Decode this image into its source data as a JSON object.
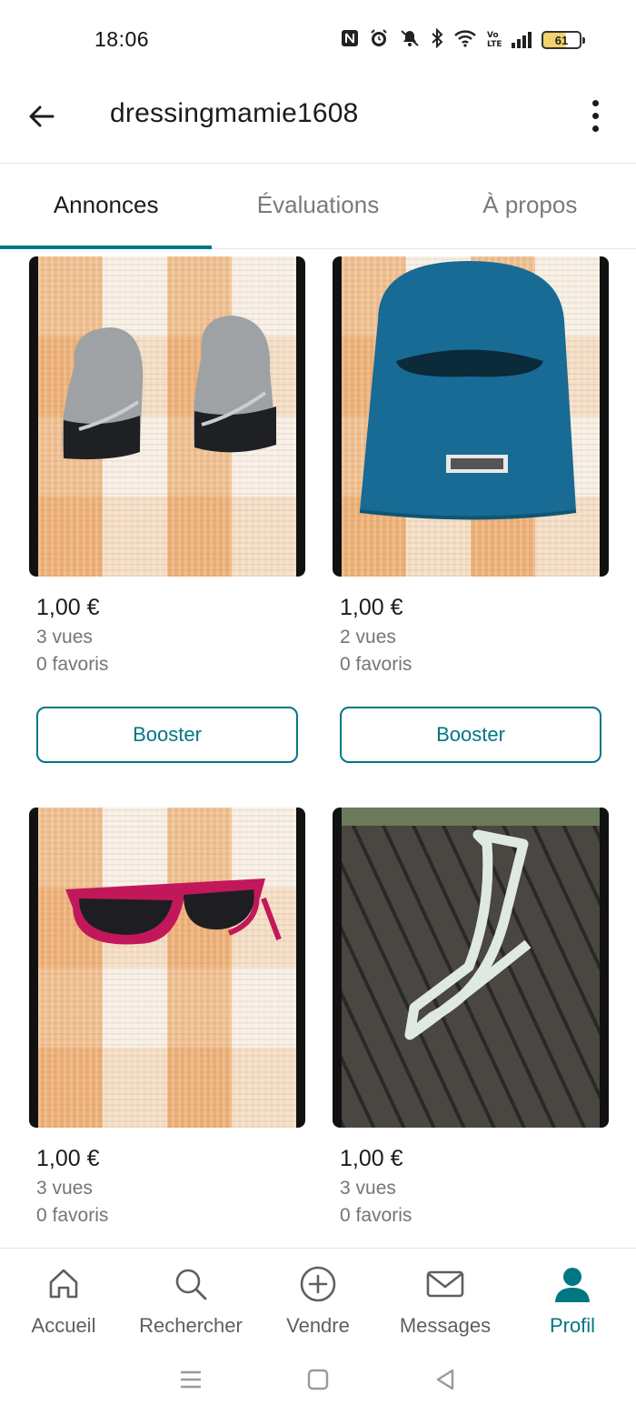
{
  "status_bar": {
    "time": "18:06",
    "battery": "61",
    "icons": [
      "nfc-icon",
      "alarm-icon",
      "mute-icon",
      "bluetooth-icon",
      "wifi-icon",
      "volte-icon",
      "signal-icon",
      "battery-icon"
    ]
  },
  "header": {
    "title": "dressingmamie1608",
    "back_icon": "arrow-left-icon",
    "more_icon": "more-vertical-icon"
  },
  "tabs": [
    {
      "label": "Annonces",
      "active": true
    },
    {
      "label": "Évaluations",
      "active": false
    },
    {
      "label": "À propos",
      "active": false
    }
  ],
  "listings": [
    {
      "price": "1,00 €",
      "views": "3 vues",
      "favorites": "0 favoris",
      "button": "Booster",
      "image": "gloves-photo"
    },
    {
      "price": "1,00 €",
      "views": "2 vues",
      "favorites": "0 favoris",
      "button": "Booster",
      "image": "balaclava-photo"
    },
    {
      "price": "1,00 €",
      "views": "3 vues",
      "favorites": "0 favoris",
      "image": "sunglasses-photo"
    },
    {
      "price": "1,00 €",
      "views": "3 vues",
      "favorites": "0 favoris",
      "image": "lanyard-photo"
    }
  ],
  "bottom_nav": [
    {
      "label": "Accueil",
      "icon": "home-icon"
    },
    {
      "label": "Rechercher",
      "icon": "search-icon"
    },
    {
      "label": "Vendre",
      "icon": "plus-circle-icon"
    },
    {
      "label": "Messages",
      "icon": "mail-icon"
    },
    {
      "label": "Profil",
      "icon": "profile-icon",
      "active": true
    }
  ],
  "colors": {
    "accent": "#007782",
    "text": "#1c1c1c",
    "muted": "#757575"
  }
}
